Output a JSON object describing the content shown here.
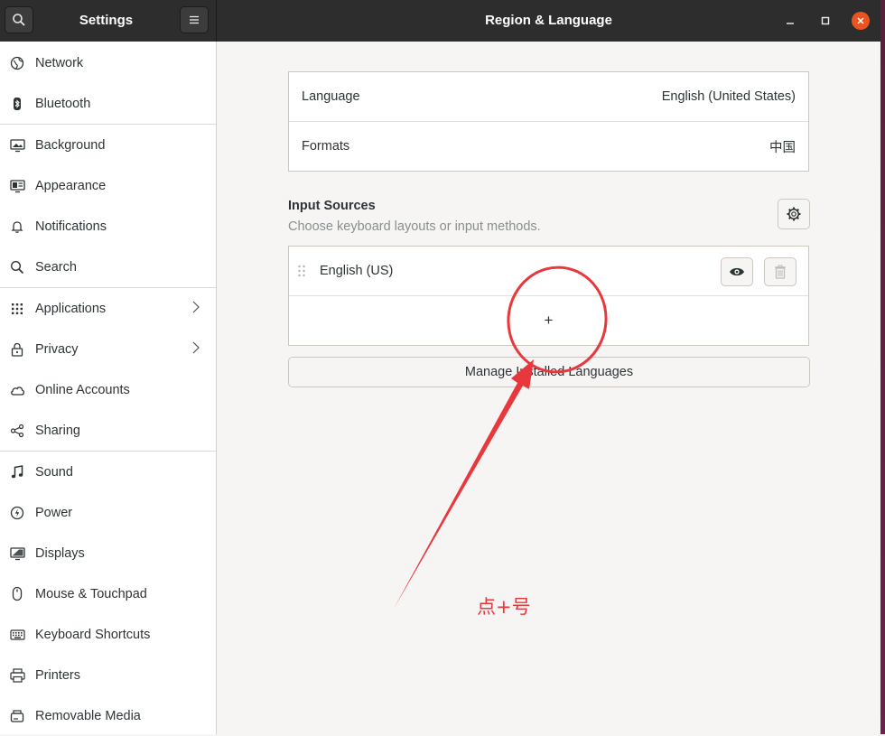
{
  "header": {
    "left_title": "Settings",
    "main_title": "Region & Language",
    "search_icon": "search-icon",
    "menu_icon": "hamburger-menu-icon"
  },
  "sidebar": {
    "items": [
      {
        "label": "Network",
        "icon": "network-globe-icon"
      },
      {
        "label": "Bluetooth",
        "icon": "bluetooth-icon"
      },
      {
        "label": "Background",
        "icon": "background-monitor-icon"
      },
      {
        "label": "Appearance",
        "icon": "appearance-icon"
      },
      {
        "label": "Notifications",
        "icon": "bell-icon"
      },
      {
        "label": "Search",
        "icon": "search-icon"
      },
      {
        "label": "Applications",
        "icon": "apps-grid-icon"
      },
      {
        "label": "Privacy",
        "icon": "lock-icon"
      },
      {
        "label": "Online Accounts",
        "icon": "cloud-icon"
      },
      {
        "label": "Sharing",
        "icon": "share-icon"
      },
      {
        "label": "Sound",
        "icon": "music-note-icon"
      },
      {
        "label": "Power",
        "icon": "power-icon"
      },
      {
        "label": "Displays",
        "icon": "display-icon"
      },
      {
        "label": "Mouse & Touchpad",
        "icon": "mouse-icon"
      },
      {
        "label": "Keyboard Shortcuts",
        "icon": "keyboard-icon"
      },
      {
        "label": "Printers",
        "icon": "printer-icon"
      },
      {
        "label": "Removable Media",
        "icon": "usb-drive-icon"
      }
    ]
  },
  "region": {
    "language_label": "Language",
    "language_value": "English (United States)",
    "formats_label": "Formats",
    "formats_value": "中国"
  },
  "input_sources": {
    "title": "Input Sources",
    "subtitle": "Choose keyboard layouts or input methods.",
    "sources": [
      {
        "label": "English (US)"
      }
    ],
    "add_label": "+",
    "manage_button": "Manage Installed Languages"
  },
  "annotation": {
    "text": "点+号",
    "color": "#e8373d"
  },
  "colors": {
    "accent": "#e95420",
    "headerbar": "#2d2d2d",
    "annotation": "#e8373d"
  }
}
